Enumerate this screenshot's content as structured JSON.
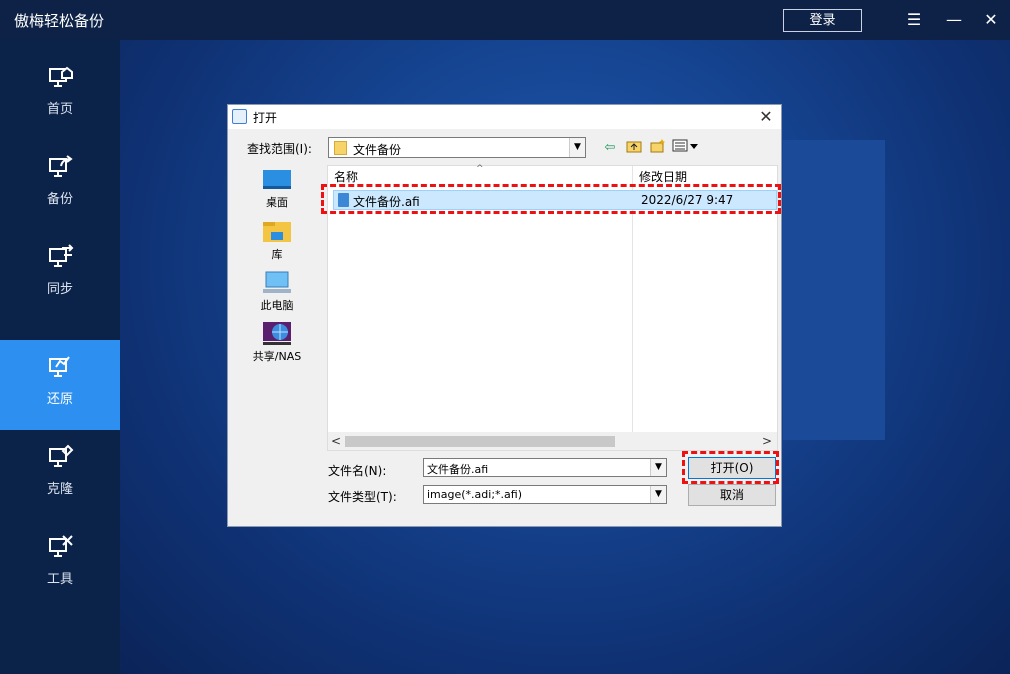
{
  "app": {
    "title": "傲梅轻松备份",
    "login_label": "登录"
  },
  "titlebar_icons": [
    "menu-icon",
    "minimize-icon",
    "close-icon"
  ],
  "sidebar": {
    "items": [
      {
        "label": "首页",
        "icon": "home-monitor-icon"
      },
      {
        "label": "备份",
        "icon": "backup-monitor-icon"
      },
      {
        "label": "同步",
        "icon": "sync-monitor-icon"
      },
      {
        "label": "还原",
        "icon": "restore-monitor-icon",
        "active": true
      },
      {
        "label": "克隆",
        "icon": "clone-monitor-icon"
      },
      {
        "label": "工具",
        "icon": "tools-monitor-icon"
      }
    ]
  },
  "dialog": {
    "title": "打开",
    "look_in_label": "查找范围(I):",
    "look_in_value": "文件备份",
    "places": [
      {
        "label": "桌面",
        "icon": "desktop-icon"
      },
      {
        "label": "库",
        "icon": "library-icon"
      },
      {
        "label": "此电脑",
        "icon": "computer-icon"
      },
      {
        "label": "共享/NAS",
        "icon": "network-share-icon"
      }
    ],
    "columns": {
      "name": "名称",
      "modified": "修改日期"
    },
    "files": [
      {
        "name": "文件备份.afi",
        "modified": "2022/6/27 9:47",
        "selected": true
      }
    ],
    "filename_label": "文件名(N):",
    "filename_value": "文件备份.afi",
    "filetype_label": "文件类型(T):",
    "filetype_value": "image(*.adi;*.afi)",
    "open_label": "打开(O)",
    "cancel_label": "取消"
  },
  "colors": {
    "accent": "#2d8ff0",
    "highlight": "#e11111",
    "sidebar_bg": "#0c2349"
  }
}
